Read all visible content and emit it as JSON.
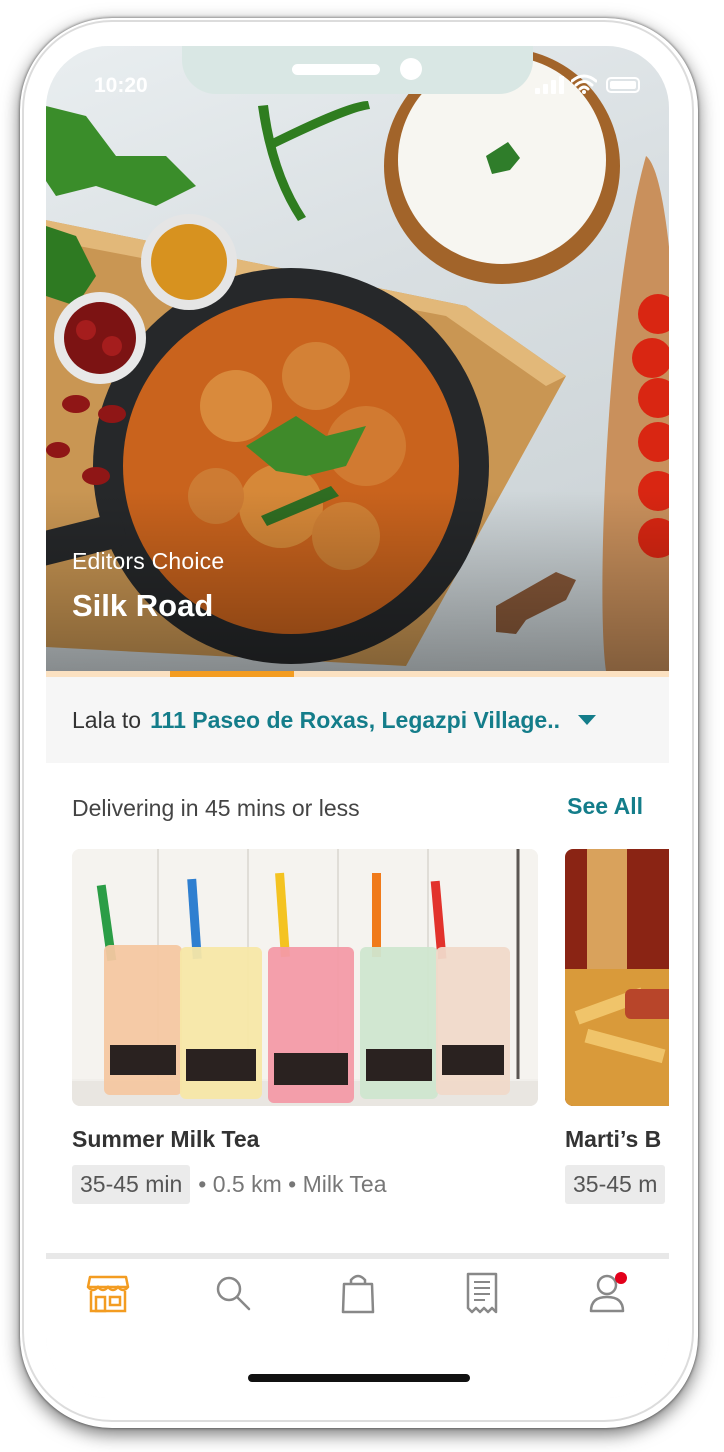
{
  "status_bar": {
    "time": "10:20"
  },
  "hero": {
    "kicker": "Editors Choice",
    "title": "Silk Road"
  },
  "carousel": {
    "pages": 5,
    "active_index": 1
  },
  "address": {
    "name": "Lala to",
    "value": "111 Paseo de Roxas, Legazpi Village.."
  },
  "section": {
    "title": "Delivering in 45 mins or less",
    "see_all": "See All",
    "cards": [
      {
        "name": "Summer Milk Tea",
        "eta": "35-45 min",
        "meta": "• 0.5 km • Milk Tea"
      },
      {
        "name": "Marti’s B",
        "eta": "35-45 m",
        "meta": ""
      }
    ]
  },
  "nav": {
    "items": [
      {
        "icon": "store-icon",
        "active": true
      },
      {
        "icon": "search-icon",
        "active": false
      },
      {
        "icon": "bag-icon",
        "active": false
      },
      {
        "icon": "receipt-icon",
        "active": false
      },
      {
        "icon": "profile-icon",
        "active": false,
        "badge": true
      }
    ]
  },
  "colors": {
    "accent_teal": "#147d8a",
    "accent_orange": "#f39c21",
    "badge_red": "#e3001b"
  }
}
